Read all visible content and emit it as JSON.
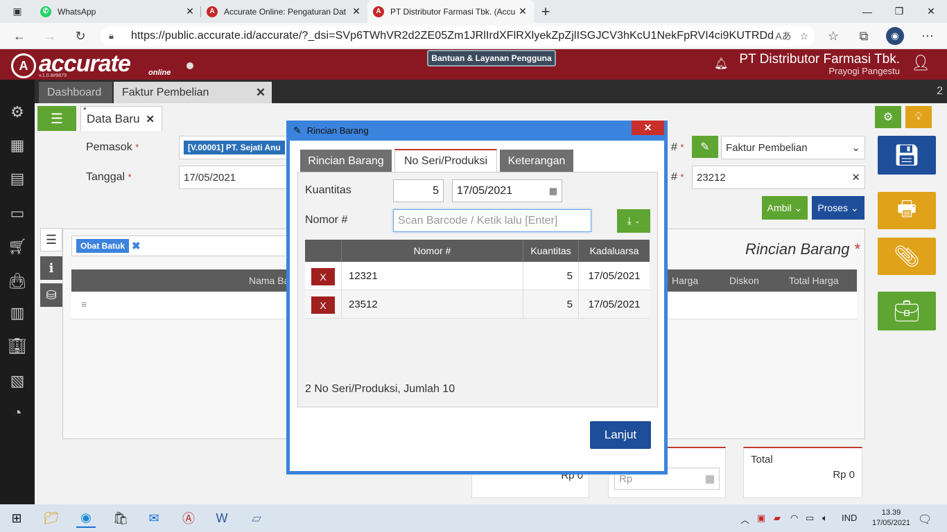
{
  "browser": {
    "tabs": [
      {
        "title": "WhatsApp",
        "icon": "whatsapp-icon",
        "color": "#25d366"
      },
      {
        "title": "Accurate Online: Pengaturan Dat",
        "icon": "accurate-icon",
        "color": "#c62828"
      },
      {
        "title": "PT Distributor Farmasi Tbk. (Accu",
        "icon": "accurate-icon",
        "color": "#c62828"
      }
    ],
    "url": "https://public.accurate.id/accurate/?_dsi=SVp6TWhVR2d2ZE05Zm1JRlIrdXFlRXlyekZpZjlISGJCV3hKcU1NekFpRVI4ci9KUTRDdW..."
  },
  "app": {
    "logo_text": "accurate",
    "logo_sub": "online",
    "version": "v.1.0.8#9879",
    "help_label": "Bantuan & Layanan Pengguna",
    "company": "PT Distributor Farmasi Tbk.",
    "user": "Prayogi Pangestu"
  },
  "page_tabs": {
    "dashboard": "Dashboard",
    "faktur": "Faktur Pembelian",
    "count": "2"
  },
  "form": {
    "subtab": "Data Baru",
    "pemasok_label": "Pemasok",
    "pemasok_value": "[V.00001] PT. Sejati Anu",
    "tanggal_label": "Tanggal",
    "tanggal_value": "17/05/2021",
    "tipe_value": "Faktur Pembelian",
    "nomor_value": "23212",
    "ambil_label": "Ambil",
    "proses_label": "Proses",
    "item_tag": "Obat Batuk",
    "section_title": "Rincian Barang",
    "columns": [
      "Nama Ba",
      "Harga",
      "Diskon",
      "Total Harga"
    ],
    "total_label": "Total",
    "total_value": "Rp 0",
    "rp_left": "Rp 0",
    "rp_placeholder": "Rp"
  },
  "modal": {
    "title": "Rincian Barang",
    "tabs": [
      "Rincian Barang",
      "No Seri/Produksi",
      "Keterangan"
    ],
    "kuantitas_label": "Kuantitas",
    "kuantitas_value": "5",
    "date_value": "17/05/2021",
    "nomor_label": "Nomor #",
    "nomor_placeholder": "Scan Barcode / Ketik lalu [Enter]",
    "table_headers": [
      "Nomor #",
      "Kuantitas",
      "Kadaluarsa"
    ],
    "rows": [
      {
        "nomor": "12321",
        "kuantitas": "5",
        "kadaluarsa": "17/05/2021",
        "remove": "X"
      },
      {
        "nomor": "23512",
        "kuantitas": "5",
        "kadaluarsa": "17/05/2021",
        "remove": "X"
      }
    ],
    "summary": "2 No Seri/Produksi, Jumlah 10",
    "next_label": "Lanjut"
  },
  "taskbar": {
    "lang": "IND",
    "time": "13.39",
    "date": "17/05/2021"
  }
}
